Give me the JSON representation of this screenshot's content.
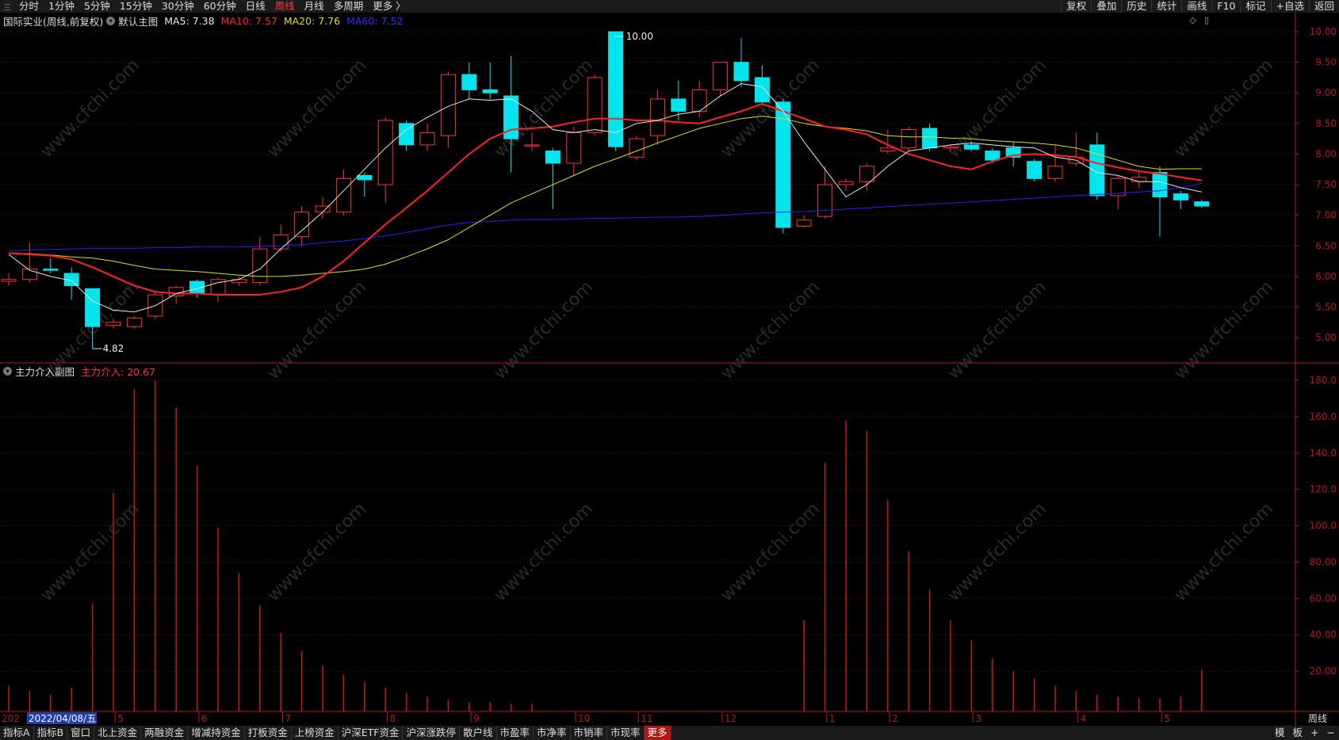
{
  "toolbar": {
    "menu_glyph": "三",
    "periods": [
      "分时",
      "1分钟",
      "5分钟",
      "15分钟",
      "30分钟",
      "60分钟",
      "日线",
      "周线",
      "月线",
      "多周期",
      "更多 〉"
    ],
    "active_period": "周线",
    "tools": [
      "复权",
      "叠加",
      "历史",
      "统计",
      "画线",
      "F10",
      "标记",
      "+自选",
      "返回"
    ]
  },
  "main_header": {
    "stock": "国际实业(周线,前复权)",
    "view": "默认主图",
    "ma5": "MA5: 7.38",
    "ma10": "MA10: 7.57",
    "ma20": "MA20: 7.76",
    "ma60": "MA60: 7.52"
  },
  "sub_header": {
    "name": "主力介入副图",
    "value": "主力介入: 20.67"
  },
  "colors": {
    "up": "#ff3030",
    "down": "#00e5ee",
    "ma5": "#e8e8e8",
    "ma10": "#ff2020",
    "ma20": "#e0e000",
    "ma60": "#2020ff",
    "bar": "#e01010",
    "axis": "#b31515"
  },
  "chart_data": [
    {
      "type": "candlestick",
      "title": "国际实业(周线,前复权)",
      "y_ticks": [
        "10.00",
        "9.50",
        "9.00",
        "8.50",
        "8.00",
        "7.50",
        "7.00",
        "6.50",
        "6.00",
        "5.50",
        "5.00"
      ],
      "ylim": [
        4.7,
        10.1
      ],
      "annotations": {
        "high": "10.00",
        "low": "4.82"
      },
      "candles": [
        {
          "o": 5.92,
          "h": 6.05,
          "l": 5.85,
          "c": 5.95
        },
        {
          "o": 5.95,
          "h": 6.55,
          "l": 5.9,
          "c": 6.12
        },
        {
          "o": 6.12,
          "h": 6.3,
          "l": 6.05,
          "c": 6.1
        },
        {
          "o": 6.05,
          "h": 6.15,
          "l": 5.62,
          "c": 5.85
        },
        {
          "o": 5.8,
          "h": 5.8,
          "l": 4.82,
          "c": 5.18
        },
        {
          "o": 5.2,
          "h": 5.32,
          "l": 5.15,
          "c": 5.25
        },
        {
          "o": 5.18,
          "h": 5.35,
          "l": 5.15,
          "c": 5.32
        },
        {
          "o": 5.35,
          "h": 5.75,
          "l": 5.3,
          "c": 5.7
        },
        {
          "o": 5.68,
          "h": 5.85,
          "l": 5.55,
          "c": 5.82
        },
        {
          "o": 5.92,
          "h": 5.95,
          "l": 5.65,
          "c": 5.72
        },
        {
          "o": 5.7,
          "h": 5.98,
          "l": 5.58,
          "c": 5.95
        },
        {
          "o": 5.9,
          "h": 6.0,
          "l": 5.85,
          "c": 5.95
        },
        {
          "o": 5.9,
          "h": 6.65,
          "l": 5.85,
          "c": 6.45
        },
        {
          "o": 6.45,
          "h": 6.85,
          "l": 6.4,
          "c": 6.68
        },
        {
          "o": 6.65,
          "h": 7.15,
          "l": 6.5,
          "c": 7.05
        },
        {
          "o": 7.05,
          "h": 7.3,
          "l": 6.95,
          "c": 7.15
        },
        {
          "o": 7.05,
          "h": 7.75,
          "l": 7.0,
          "c": 7.6
        },
        {
          "o": 7.65,
          "h": 7.7,
          "l": 7.3,
          "c": 7.58
        },
        {
          "o": 7.5,
          "h": 8.6,
          "l": 7.2,
          "c": 8.55
        },
        {
          "o": 8.5,
          "h": 8.55,
          "l": 8.05,
          "c": 8.15
        },
        {
          "o": 8.15,
          "h": 8.5,
          "l": 8.05,
          "c": 8.35
        },
        {
          "o": 8.3,
          "h": 9.35,
          "l": 8.1,
          "c": 9.3
        },
        {
          "o": 9.3,
          "h": 9.5,
          "l": 8.9,
          "c": 9.05
        },
        {
          "o": 9.05,
          "h": 9.5,
          "l": 8.9,
          "c": 9.0
        },
        {
          "o": 8.95,
          "h": 9.6,
          "l": 7.7,
          "c": 8.25
        },
        {
          "o": 8.15,
          "h": 8.35,
          "l": 8.05,
          "c": 8.15
        },
        {
          "o": 8.05,
          "h": 8.1,
          "l": 7.1,
          "c": 7.85
        },
        {
          "o": 7.85,
          "h": 8.45,
          "l": 7.65,
          "c": 8.35
        },
        {
          "o": 8.35,
          "h": 9.3,
          "l": 8.3,
          "c": 9.25
        },
        {
          "o": 10.0,
          "h": 10.0,
          "l": 8.05,
          "c": 8.12
        },
        {
          "o": 7.95,
          "h": 8.3,
          "l": 7.9,
          "c": 8.25
        },
        {
          "o": 8.3,
          "h": 9.05,
          "l": 8.15,
          "c": 8.9
        },
        {
          "o": 8.9,
          "h": 9.2,
          "l": 8.55,
          "c": 8.7
        },
        {
          "o": 8.7,
          "h": 9.2,
          "l": 8.6,
          "c": 9.05
        },
        {
          "o": 9.05,
          "h": 9.5,
          "l": 8.95,
          "c": 9.5
        },
        {
          "o": 9.5,
          "h": 9.9,
          "l": 9.1,
          "c": 9.2
        },
        {
          "o": 9.25,
          "h": 9.45,
          "l": 8.8,
          "c": 8.85
        },
        {
          "o": 8.85,
          "h": 8.9,
          "l": 6.7,
          "c": 6.8
        },
        {
          "o": 6.82,
          "h": 7.0,
          "l": 6.8,
          "c": 6.92
        },
        {
          "o": 6.98,
          "h": 7.8,
          "l": 6.95,
          "c": 7.5
        },
        {
          "o": 7.5,
          "h": 7.6,
          "l": 7.4,
          "c": 7.55
        },
        {
          "o": 7.55,
          "h": 7.85,
          "l": 7.4,
          "c": 7.8
        },
        {
          "o": 8.05,
          "h": 8.4,
          "l": 8.0,
          "c": 8.1
        },
        {
          "o": 8.1,
          "h": 8.45,
          "l": 8.05,
          "c": 8.4
        },
        {
          "o": 8.42,
          "h": 8.5,
          "l": 8.05,
          "c": 8.1
        },
        {
          "o": 8.1,
          "h": 8.15,
          "l": 8.05,
          "c": 8.12
        },
        {
          "o": 8.15,
          "h": 8.2,
          "l": 8.05,
          "c": 8.08
        },
        {
          "o": 8.05,
          "h": 8.1,
          "l": 7.85,
          "c": 7.9
        },
        {
          "o": 8.1,
          "h": 8.2,
          "l": 7.8,
          "c": 7.95
        },
        {
          "o": 7.88,
          "h": 7.92,
          "l": 7.55,
          "c": 7.6
        },
        {
          "o": 7.6,
          "h": 8.15,
          "l": 7.55,
          "c": 7.8
        },
        {
          "o": 7.85,
          "h": 8.35,
          "l": 7.8,
          "c": 7.95
        },
        {
          "o": 8.15,
          "h": 8.35,
          "l": 7.25,
          "c": 7.32
        },
        {
          "o": 7.32,
          "h": 7.65,
          "l": 7.1,
          "c": 7.6
        },
        {
          "o": 7.55,
          "h": 7.7,
          "l": 7.45,
          "c": 7.62
        },
        {
          "o": 7.7,
          "h": 7.8,
          "l": 6.65,
          "c": 7.3
        },
        {
          "o": 7.35,
          "h": 7.4,
          "l": 7.1,
          "c": 7.25
        },
        {
          "o": 7.22,
          "h": 7.25,
          "l": 7.12,
          "c": 7.15
        }
      ],
      "ma5": [
        6.36,
        6.1,
        6.0,
        5.93,
        5.6,
        5.45,
        5.42,
        5.52,
        5.72,
        5.8,
        5.9,
        5.95,
        6.12,
        6.45,
        6.75,
        7.05,
        7.4,
        7.75,
        8.1,
        8.4,
        8.6,
        8.78,
        8.9,
        8.88,
        8.9,
        8.7,
        8.4,
        8.35,
        8.4,
        8.35,
        8.5,
        8.55,
        8.65,
        8.7,
        8.95,
        9.15,
        9.1,
        8.7,
        8.2,
        7.75,
        7.3,
        7.5,
        7.8,
        8.05,
        8.1,
        8.15,
        8.18,
        8.15,
        8.12,
        8.1,
        7.95,
        7.9,
        7.7,
        7.65,
        7.55,
        7.55,
        7.45,
        7.38
      ],
      "ma10": [
        6.38,
        6.36,
        6.34,
        6.28,
        6.15,
        6.0,
        5.85,
        5.75,
        5.72,
        5.72,
        5.7,
        5.7,
        5.7,
        5.75,
        5.82,
        6.0,
        6.25,
        6.55,
        6.85,
        7.12,
        7.4,
        7.7,
        8.0,
        8.25,
        8.4,
        8.42,
        8.45,
        8.52,
        8.58,
        8.58,
        8.55,
        8.55,
        8.52,
        8.5,
        8.6,
        8.7,
        8.82,
        8.7,
        8.58,
        8.45,
        8.4,
        8.32,
        8.15,
        8.0,
        7.9,
        7.8,
        7.75,
        7.88,
        7.98,
        8.0,
        7.98,
        7.95,
        7.85,
        7.78,
        7.72,
        7.68,
        7.62,
        7.57
      ],
      "ma20": [
        6.38,
        6.37,
        6.35,
        6.32,
        6.3,
        6.25,
        6.18,
        6.12,
        6.1,
        6.08,
        6.05,
        6.02,
        6.0,
        6.0,
        6.02,
        6.05,
        6.08,
        6.12,
        6.2,
        6.32,
        6.45,
        6.6,
        6.8,
        7.0,
        7.2,
        7.35,
        7.5,
        7.65,
        7.8,
        7.92,
        8.05,
        8.18,
        8.3,
        8.42,
        8.5,
        8.58,
        8.62,
        8.58,
        8.5,
        8.45,
        8.42,
        8.38,
        8.3,
        8.28,
        8.28,
        8.26,
        8.25,
        8.22,
        8.2,
        8.18,
        8.15,
        8.1,
        8.0,
        7.9,
        7.8,
        7.75,
        7.76,
        7.76
      ],
      "ma60": [
        6.42,
        6.43,
        6.44,
        6.45,
        6.46,
        6.46,
        6.46,
        6.47,
        6.47,
        6.48,
        6.48,
        6.48,
        6.49,
        6.5,
        6.52,
        6.55,
        6.58,
        6.62,
        6.66,
        6.72,
        6.78,
        6.84,
        6.88,
        6.9,
        6.92,
        6.93,
        6.93,
        6.94,
        6.95,
        6.95,
        6.96,
        6.97,
        6.97,
        6.98,
        7.0,
        7.02,
        7.04,
        7.05,
        7.06,
        7.08,
        7.1,
        7.12,
        7.14,
        7.16,
        7.18,
        7.2,
        7.22,
        7.24,
        7.26,
        7.28,
        7.3,
        7.32,
        7.34,
        7.36,
        7.38,
        7.4,
        7.45,
        7.52
      ]
    },
    {
      "type": "bar",
      "title": "主力介入副图",
      "y_ticks": [
        "180.0",
        "160.0",
        "140.0",
        "120.0",
        "100.0",
        "80.00",
        "60.00",
        "40.00",
        "20.00"
      ],
      "ylim": [
        0,
        190
      ],
      "bars": [
        {
          "i": 0,
          "v": 12
        },
        {
          "i": 1,
          "v": 9
        },
        {
          "i": 2,
          "v": 7
        },
        {
          "i": 3,
          "v": 11
        },
        {
          "i": 4,
          "v": 57
        },
        {
          "i": 5,
          "v": 118
        },
        {
          "i": 6,
          "v": 175
        },
        {
          "i": 7,
          "v": 180
        },
        {
          "i": 8,
          "v": 165
        },
        {
          "i": 9,
          "v": 133
        },
        {
          "i": 10,
          "v": 99
        },
        {
          "i": 11,
          "v": 74
        },
        {
          "i": 12,
          "v": 56
        },
        {
          "i": 13,
          "v": 41
        },
        {
          "i": 14,
          "v": 31
        },
        {
          "i": 15,
          "v": 23
        },
        {
          "i": 16,
          "v": 18
        },
        {
          "i": 17,
          "v": 14
        },
        {
          "i": 18,
          "v": 11
        },
        {
          "i": 19,
          "v": 8
        },
        {
          "i": 20,
          "v": 6
        },
        {
          "i": 21,
          "v": 4
        },
        {
          "i": 22,
          "v": 3
        },
        {
          "i": 23,
          "v": 3
        },
        {
          "i": 24,
          "v": 2
        },
        {
          "i": 25,
          "v": 2
        },
        {
          "i": 38,
          "v": 48
        },
        {
          "i": 39,
          "v": 135
        },
        {
          "i": 40,
          "v": 158
        },
        {
          "i": 41,
          "v": 152
        },
        {
          "i": 42,
          "v": 114
        },
        {
          "i": 43,
          "v": 86
        },
        {
          "i": 44,
          "v": 65
        },
        {
          "i": 45,
          "v": 48
        },
        {
          "i": 46,
          "v": 37
        },
        {
          "i": 47,
          "v": 27
        },
        {
          "i": 48,
          "v": 20
        },
        {
          "i": 49,
          "v": 16
        },
        {
          "i": 50,
          "v": 12
        },
        {
          "i": 51,
          "v": 9
        },
        {
          "i": 52,
          "v": 7
        },
        {
          "i": 53,
          "v": 6
        },
        {
          "i": 54,
          "v": 5
        },
        {
          "i": 55,
          "v": 5
        },
        {
          "i": 56,
          "v": 6
        },
        {
          "i": 57,
          "v": 21
        }
      ],
      "x_labels": [
        {
          "i": 0,
          "text": "202"
        },
        {
          "i": 5.2,
          "text": "5"
        },
        {
          "i": 9.2,
          "text": "6"
        },
        {
          "i": 13.2,
          "text": "7"
        },
        {
          "i": 18.2,
          "text": "8"
        },
        {
          "i": 22.2,
          "text": "9"
        },
        {
          "i": 27.2,
          "text": "10"
        },
        {
          "i": 30.2,
          "text": "11"
        },
        {
          "i": 34.2,
          "text": "12"
        },
        {
          "i": 39.2,
          "text": "1"
        },
        {
          "i": 42.2,
          "text": "2"
        },
        {
          "i": 46.2,
          "text": "3"
        },
        {
          "i": 51.2,
          "text": "4"
        },
        {
          "i": 55.2,
          "text": "5"
        }
      ],
      "cursor_date": "2022/04/08/五",
      "period_label": "周线"
    }
  ],
  "bottom": {
    "tabs": [
      "指标A",
      "指标B",
      "窗口",
      "北上资金",
      "两融资金",
      "增减持资金",
      "打板资金",
      "上榜资金",
      "沪深ETF资金",
      "沪深涨跌停",
      "散户线",
      "市盈率",
      "市净率",
      "市销率",
      "市现率",
      "更多"
    ],
    "active_tab": "更多",
    "right": [
      "模",
      "板",
      "+",
      "−"
    ]
  },
  "watermark": "www.cfchi.com"
}
